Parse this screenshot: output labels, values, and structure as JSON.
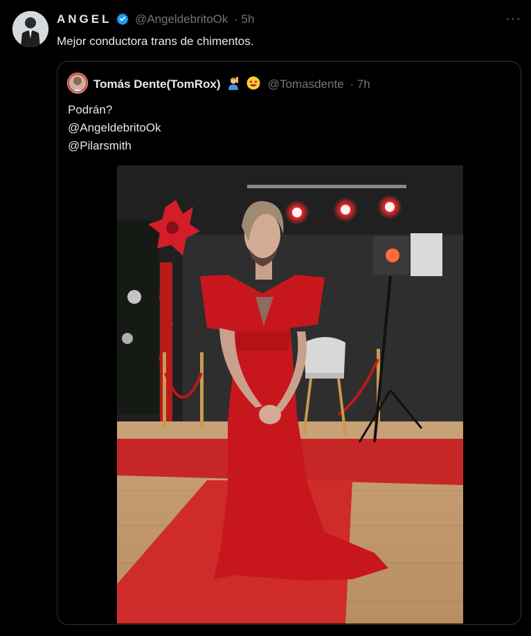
{
  "tweet": {
    "author_name": "ANGEL",
    "handle": "@AngeldebritoOk",
    "time": "· 5h",
    "text": "Mejor conductora trans de chimentos.",
    "more_icon": "more-icon",
    "verified_icon": "verified-badge-icon"
  },
  "quoted": {
    "author_name": "Tomás Dente(TomRox)",
    "handle": "@Tomasdente",
    "time": "· 7h",
    "lines": [
      "Podrán?",
      "@AngeldebritoOk",
      "@Pilarsmith"
    ],
    "emojis": [
      "person-raising-hand-emoji",
      "star-struck-emoji"
    ]
  },
  "colors": {
    "background": "#000000",
    "text": "#e7e9ea",
    "secondary_text": "#71767b",
    "verified": "#1d9bf0",
    "border": "#2f3336",
    "dress_red": "#c8161d"
  }
}
